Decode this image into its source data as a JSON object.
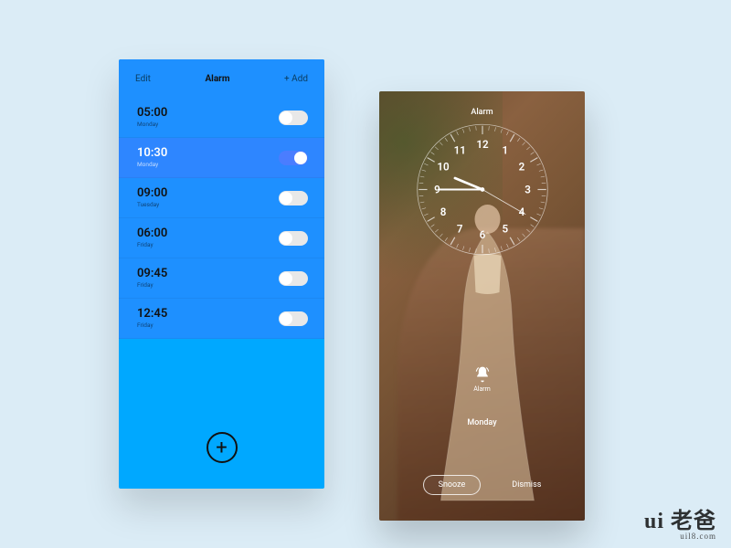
{
  "left": {
    "header": {
      "edit": "Edit",
      "title": "Alarm",
      "add": "+ Add"
    },
    "alarms": [
      {
        "time": "05:00",
        "day": "Monday",
        "on": false
      },
      {
        "time": "10:30",
        "day": "Monday",
        "on": true
      },
      {
        "time": "09:00",
        "day": "Tuesday",
        "on": false
      },
      {
        "time": "06:00",
        "day": "Friday",
        "on": false
      },
      {
        "time": "09:45",
        "day": "Friday",
        "on": false
      },
      {
        "time": "12:45",
        "day": "Friday",
        "on": false
      }
    ],
    "add_icon": "+"
  },
  "right": {
    "title": "Alarm",
    "bell_label": "Alarm",
    "day": "Monday",
    "snooze": "Snooze",
    "dismiss": "Dismiss",
    "clock": {
      "hour": 9,
      "minute": 45,
      "second": 20
    }
  },
  "watermark": {
    "brand": "ui 老爸",
    "url": "uil8.com"
  }
}
